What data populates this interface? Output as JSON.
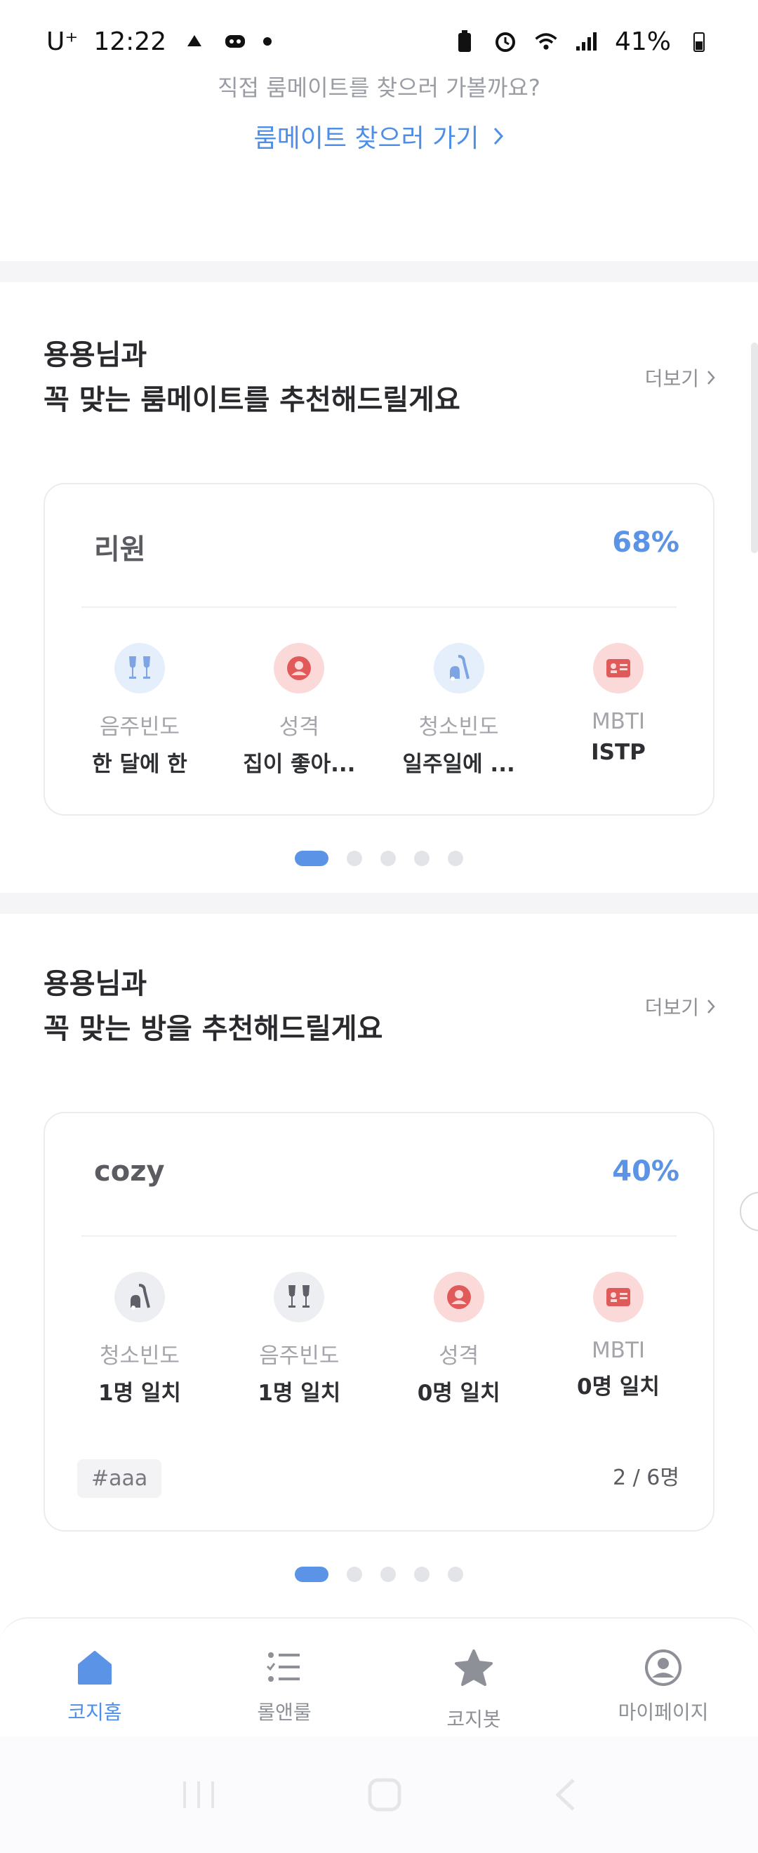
{
  "status_bar": {
    "carrier": "U⁺",
    "time": "12:22",
    "battery": "41%"
  },
  "prompt": {
    "subtitle": "직접 룸메이트를 찾으러 가볼까요?",
    "link": "룸메이트 찾으러 가기"
  },
  "roommate_section": {
    "title_line1": "용용님과",
    "title_line2": "꼭 맞는 룸메이트를 추천해드릴게요",
    "more_label": "더보기",
    "card": {
      "name": "리원",
      "match": "68%",
      "attributes": [
        {
          "label": "음주빈도",
          "value": "한 달에 한",
          "icon": "wine-glasses-icon"
        },
        {
          "label": "성격",
          "value": "집이 좋아...",
          "icon": "person-circle-icon"
        },
        {
          "label": "청소빈도",
          "value": "일주일에 ...",
          "icon": "vacuum-icon"
        },
        {
          "label": "MBTI",
          "value": "ISTP",
          "icon": "id-card-icon"
        }
      ]
    }
  },
  "room_section": {
    "title_line1": "용용님과",
    "title_line2": "꼭 맞는 방을 추천해드릴게요",
    "more_label": "더보기",
    "card": {
      "name": "cozy",
      "match": "40%",
      "attributes": [
        {
          "label": "청소빈도",
          "value": "1명 일치",
          "icon": "vacuum-icon"
        },
        {
          "label": "음주빈도",
          "value": "1명 일치",
          "icon": "wine-glasses-icon"
        },
        {
          "label": "성격",
          "value": "0명 일치",
          "icon": "person-circle-icon"
        },
        {
          "label": "MBTI",
          "value": "0명 일치",
          "icon": "id-card-icon"
        }
      ],
      "tag": "#aaa",
      "count": "2 / 6명"
    }
  },
  "bottom_nav": {
    "items": [
      {
        "label": "코지홈",
        "icon": "home-icon"
      },
      {
        "label": "롤앤룰",
        "icon": "checklist-icon"
      },
      {
        "label": "코지봇",
        "icon": "star-icon"
      },
      {
        "label": "마이페이지",
        "icon": "profile-icon"
      }
    ]
  },
  "colors": {
    "accent": "#5b93e6",
    "muted": "#9a9da3",
    "red_icon": "#e05a5a"
  }
}
